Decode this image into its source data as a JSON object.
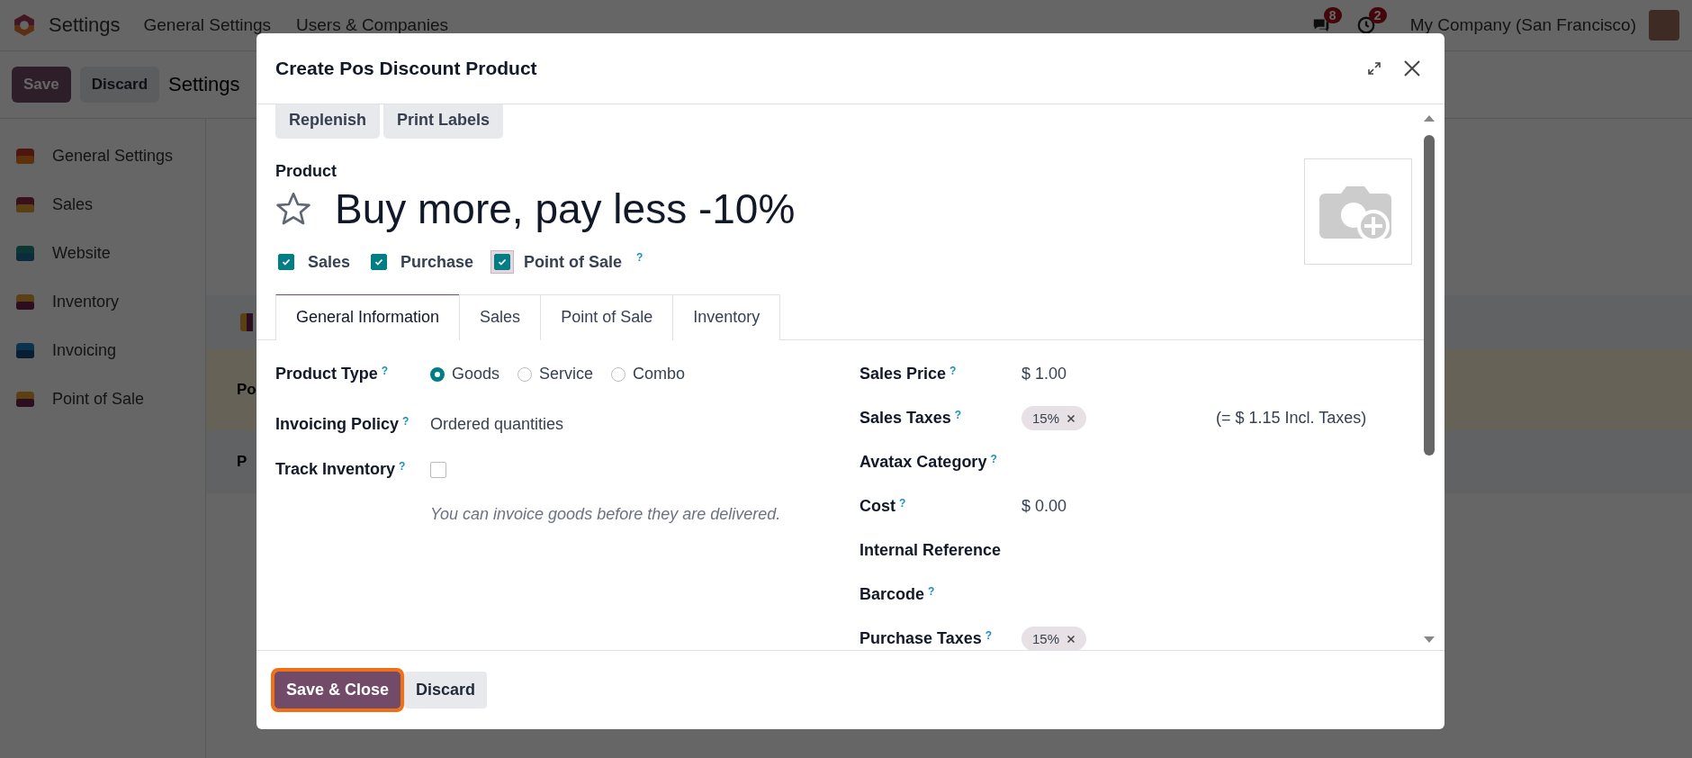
{
  "topbar": {
    "app_name": "Settings",
    "menu": [
      "General Settings",
      "Users & Companies"
    ],
    "messages_badge": "8",
    "activities_badge": "2",
    "company": "My Company (San Francisco)"
  },
  "control_bar": {
    "buttons": [
      {
        "label": "Save",
        "kind": "primary"
      },
      {
        "label": "Discard",
        "kind": "secondary"
      }
    ],
    "title": "Settings"
  },
  "sidebar": {
    "items": [
      {
        "label": "General Settings"
      },
      {
        "label": "Sales"
      },
      {
        "label": "Website"
      },
      {
        "label": "Inventory"
      },
      {
        "label": "Invoicing"
      },
      {
        "label": "Point of Sale"
      }
    ]
  },
  "background_rows": [
    {
      "text": "Po"
    },
    {
      "text": "P"
    }
  ],
  "dialog": {
    "title": "Create Pos Discount Product",
    "smart_buttons": [
      "Replenish",
      "Print Labels"
    ],
    "name_label": "Product",
    "name": "Buy more, pay less -10%",
    "favorite": false,
    "options": [
      {
        "label": "Sales",
        "checked": true,
        "focused": false
      },
      {
        "label": "Purchase",
        "checked": true,
        "focused": false
      },
      {
        "label": "Point of Sale",
        "checked": true,
        "focused": true,
        "help": "?"
      }
    ],
    "tabs": [
      {
        "label": "General Information",
        "selected": true
      },
      {
        "label": "Sales",
        "selected": false
      },
      {
        "label": "Point of Sale",
        "selected": false
      },
      {
        "label": "Inventory",
        "selected": false
      }
    ],
    "left_fields": [
      {
        "kind": "radio",
        "label": "Product Type",
        "help": "?",
        "options": [
          {
            "label": "Goods",
            "selected": true
          },
          {
            "label": "Service",
            "selected": false
          },
          {
            "label": "Combo",
            "selected": false
          }
        ]
      },
      {
        "kind": "text",
        "label": "Invoicing Policy",
        "help": "?",
        "value": "Ordered quantities"
      },
      {
        "kind": "checkbox",
        "label": "Track Inventory",
        "help": "?",
        "checked": false
      }
    ],
    "note": "You can invoice goods before they are delivered.",
    "right_fields": [
      {
        "label": "Sales Price",
        "help": "?",
        "value": "$ 1.00"
      },
      {
        "label": "Sales Taxes",
        "help": "?",
        "tags": [
          "15%"
        ],
        "extra": "(= $ 1.15 Incl. Taxes)"
      },
      {
        "label": "Avatax Category",
        "help": "?"
      },
      {
        "label": "Cost",
        "help": "?",
        "value": "$ 0.00"
      },
      {
        "label": "Internal Reference"
      },
      {
        "label": "Barcode",
        "help": "?"
      },
      {
        "label": "Purchase Taxes",
        "help": "?",
        "tags": [
          "15%"
        ]
      }
    ],
    "footer_buttons": [
      {
        "label": "Save & Close",
        "kind": "primary",
        "focused": true
      },
      {
        "label": "Discard",
        "kind": "secondary",
        "focused": false
      }
    ]
  }
}
